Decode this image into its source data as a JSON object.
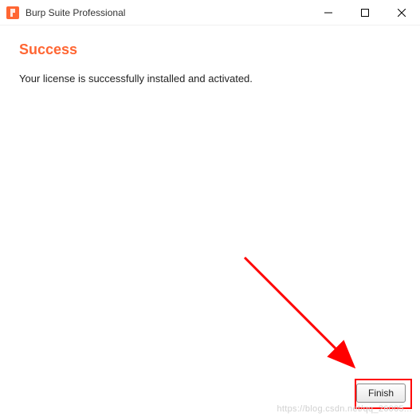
{
  "window": {
    "title": "Burp Suite Professional"
  },
  "content": {
    "heading": "Success",
    "message": "Your license is successfully installed and activated."
  },
  "actions": {
    "finish_label": "Finish"
  },
  "watermark": "https://blog.csdn.net/qq_26005..."
}
